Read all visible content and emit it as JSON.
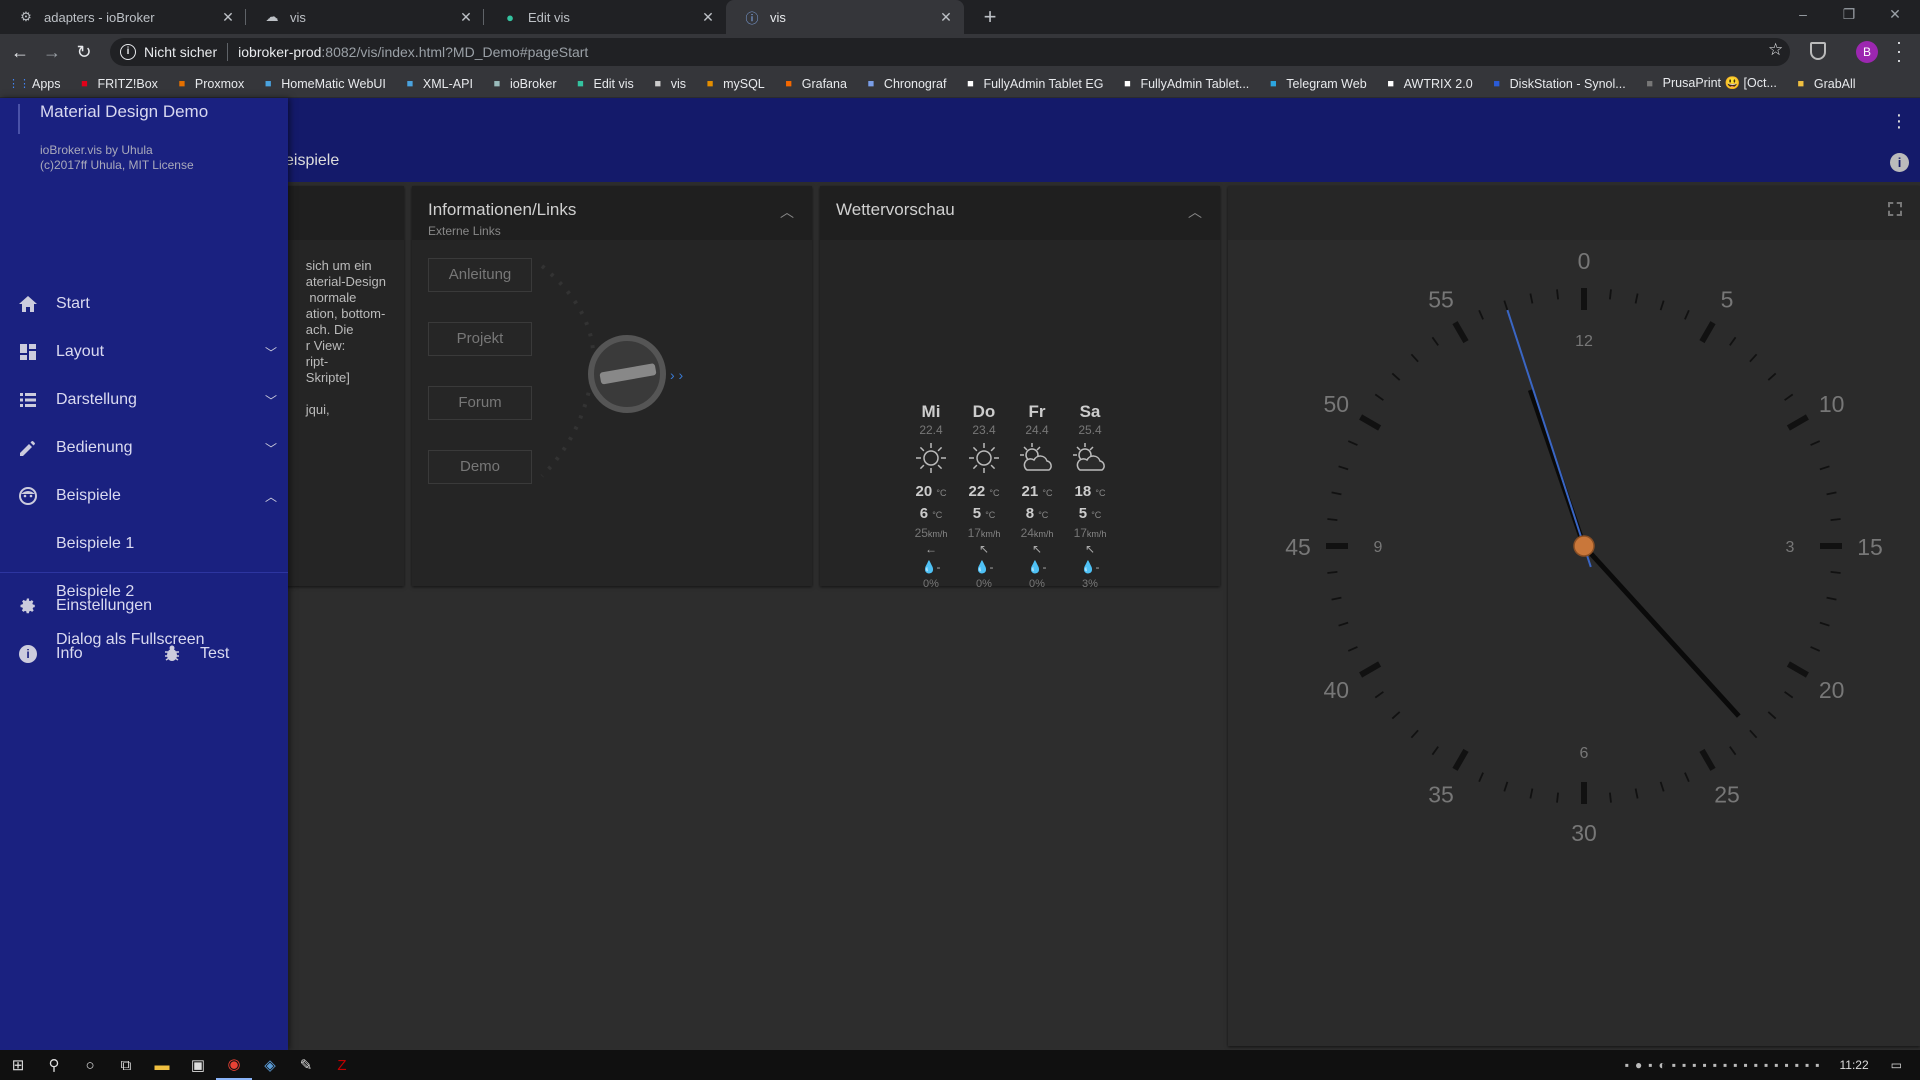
{
  "tabs": [
    {
      "title": "adapters - ioBroker",
      "icon": "iobroker-icon",
      "active": false
    },
    {
      "title": "vis",
      "icon": "vis-icon",
      "active": false
    },
    {
      "title": "Edit vis",
      "icon": "edit-vis-icon",
      "active": false
    },
    {
      "title": "vis",
      "icon": "info-icon",
      "active": true
    }
  ],
  "address": {
    "security": "Nicht sicher",
    "host": "iobroker-prod",
    "path": ":8082/vis/index.html?MD_Demo#pageStart"
  },
  "profile_initial": "B",
  "bookmarks": [
    {
      "label": "Apps",
      "icon": "apps-grid-icon",
      "color": "#4285f4"
    },
    {
      "label": "FRITZ!Box",
      "icon": "fritzbox-icon",
      "color": "#e2001a"
    },
    {
      "label": "Proxmox",
      "icon": "proxmox-icon",
      "color": "#e57000"
    },
    {
      "label": "HomeMatic WebUI",
      "icon": "homematic-icon",
      "color": "#4aa3df"
    },
    {
      "label": "XML-API",
      "icon": "xml-api-icon",
      "color": "#4aa3df"
    },
    {
      "label": "ioBroker",
      "icon": "iobroker-icon",
      "color": "#9bb"
    },
    {
      "label": "Edit vis",
      "icon": "edit-vis-icon",
      "color": "#34c3a0"
    },
    {
      "label": "vis",
      "icon": "vis-icon",
      "color": "#ccc"
    },
    {
      "label": "mySQL",
      "icon": "mysql-icon",
      "color": "#e48e00"
    },
    {
      "label": "Grafana",
      "icon": "grafana-icon",
      "color": "#f46800"
    },
    {
      "label": "Chronograf",
      "icon": "chronograf-icon",
      "color": "#7a9ee8"
    },
    {
      "label": "FullyAdmin Tablet EG",
      "icon": "fully-icon",
      "color": "#fff"
    },
    {
      "label": "FullyAdmin Tablet...",
      "icon": "fully-icon",
      "color": "#fff"
    },
    {
      "label": "Telegram Web",
      "icon": "telegram-icon",
      "color": "#2ca5e0"
    },
    {
      "label": "AWTRIX 2.0",
      "icon": "awtrix-icon",
      "color": "#fff"
    },
    {
      "label": "DiskStation - Synol...",
      "icon": "dsm-icon",
      "color": "#2a5bd7"
    },
    {
      "label": "PrusaPrint 😃 [Oct...",
      "icon": "octoprint-icon",
      "color": "#777"
    },
    {
      "label": "GrabAll",
      "icon": "folder-icon",
      "color": "#f0c040"
    }
  ],
  "appbar": {
    "subtitle": "eispiele"
  },
  "drawer": {
    "title": "Material Design Demo",
    "sub1": "ioBroker.vis by Uhula",
    "sub2": "(c)2017ff Uhula, MIT License",
    "items": [
      {
        "label": "Start",
        "icon": "home-icon",
        "chevron": ""
      },
      {
        "label": "Layout",
        "icon": "dashboard-icon",
        "chevron": "﹀"
      },
      {
        "label": "Darstellung",
        "icon": "list-icon",
        "chevron": "﹀"
      },
      {
        "label": "Bedienung",
        "icon": "pencil-icon",
        "chevron": "﹀"
      },
      {
        "label": "Beispiele",
        "icon": "face-icon",
        "chevron": "︿"
      },
      {
        "label": "Beispiele 1",
        "icon": "",
        "chevron": ""
      },
      {
        "label": "Beispiele 2",
        "icon": "",
        "chevron": ""
      },
      {
        "label": "Dialog als Fullscreen",
        "icon": "",
        "chevron": ""
      }
    ],
    "settings": "Einstellungen",
    "info": "Info",
    "test": "Test"
  },
  "left_card": {
    "lines": [
      "sich um ein",
      "aterial-Design",
      " normale",
      "ation, bottom-",
      "ach. Die",
      "r View:",
      "ript-",
      "Skripte]",
      "",
      "jqui,"
    ]
  },
  "info_card": {
    "title": "Informationen/Links",
    "subtitle": "Externe Links",
    "buttons": [
      "Anleitung",
      "Projekt",
      "Forum",
      "Demo"
    ]
  },
  "weather": {
    "title": "Wettervorschau",
    "days": [
      {
        "day": "Mi",
        "date": "22.4",
        "hi": "20",
        "lo": "6",
        "wind": "25",
        "rain": "0%",
        "icon": "sun-icon",
        "arrow": "←"
      },
      {
        "day": "Do",
        "date": "23.4",
        "hi": "22",
        "lo": "5",
        "wind": "17",
        "rain": "0%",
        "icon": "sun-icon",
        "arrow": "↖"
      },
      {
        "day": "Fr",
        "date": "24.4",
        "hi": "21",
        "lo": "8",
        "wind": "24",
        "rain": "0%",
        "icon": "partly-cloudy-icon",
        "arrow": "↖"
      },
      {
        "day": "Sa",
        "date": "25.4",
        "hi": "18",
        "lo": "5",
        "wind": "17",
        "rain": "3%",
        "icon": "partly-cloudy-icon",
        "arrow": "↖"
      }
    ],
    "temp_unit": "°C",
    "wind_unit": "km/h"
  },
  "clock": {
    "hour": 11,
    "minute": 22,
    "second": 57,
    "outer_labels": [
      "0",
      "5",
      "10",
      "15",
      "20",
      "25",
      "30",
      "35",
      "40",
      "45",
      "50",
      "55"
    ],
    "inner_labels": [
      "12",
      "3",
      "6",
      "9"
    ]
  },
  "taskbar": {
    "time": "11:22"
  }
}
